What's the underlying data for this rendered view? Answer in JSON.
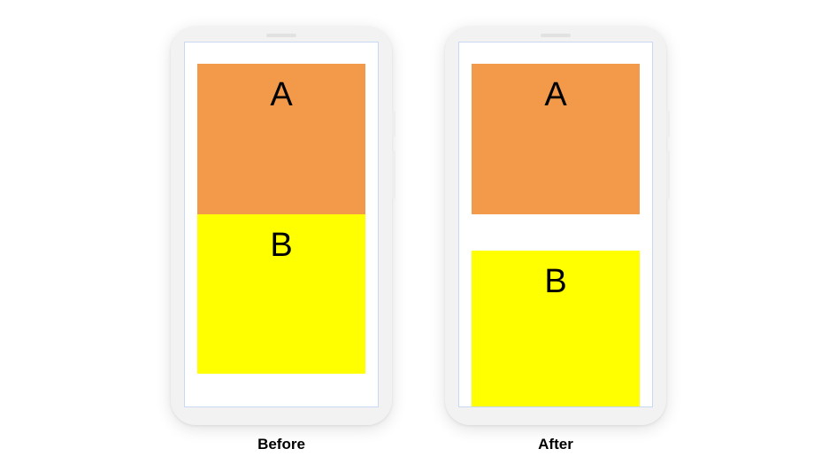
{
  "before": {
    "caption": "Before",
    "boxA": "A",
    "boxB": "B"
  },
  "after": {
    "caption": "After",
    "boxA": "A",
    "boxB": "B"
  },
  "colors": {
    "boxA": "#f2994a",
    "boxB": "#ffff00",
    "phoneBody": "#f2f2f2",
    "screenBorder": "#c9d9f3"
  }
}
